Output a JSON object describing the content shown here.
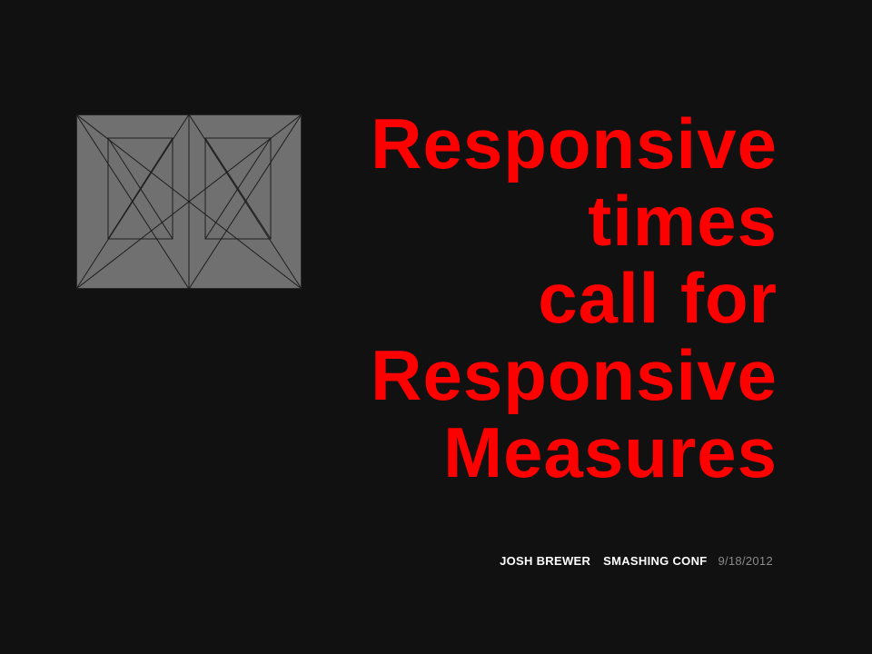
{
  "slide": {
    "title_lines": [
      "Responsive",
      "times",
      "call for",
      "Responsive",
      "Measures"
    ],
    "byline": {
      "author": "JOSH BREWER",
      "event": "SMASHING CONF",
      "date": "9/18/2012"
    }
  },
  "colors": {
    "background": "#111111",
    "title": "#ff0000",
    "byline_primary": "#ffffff",
    "byline_date": "#8a8a8a",
    "placeholder_fill": "#707070"
  },
  "icons": {
    "graphic": "wireframe-placeholder-icon"
  }
}
